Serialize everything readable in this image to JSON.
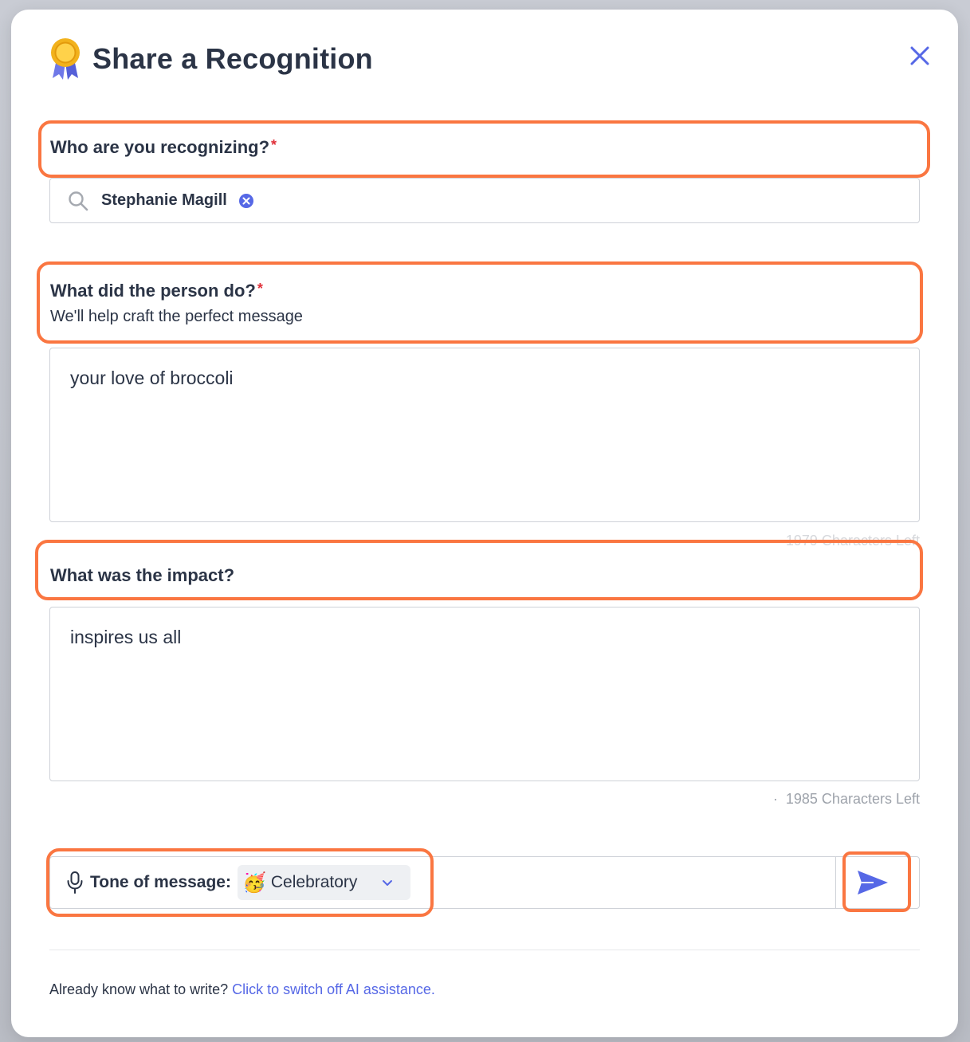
{
  "modal": {
    "title": "Share a Recognition",
    "title_icon": "award-ribbon-icon",
    "close_icon": "close-icon"
  },
  "recipient": {
    "label": "Who are you recognizing?",
    "required_mark": "*",
    "selected_name": "Stephanie Magill"
  },
  "action": {
    "label": "What did the person do?",
    "required_mark": "*",
    "subtext": "We'll help craft the perfect message",
    "value": "your love of broccoli",
    "counter": "1979 Characters Left"
  },
  "impact": {
    "label": "What was the impact?",
    "value": "inspires us all",
    "counter": "1985 Characters Left",
    "counter_bullet": "·"
  },
  "tone": {
    "label": "Tone of message:",
    "emoji": "🥳",
    "value": "Celebratory"
  },
  "footer": {
    "prompt": "Already know what to write?",
    "link": "Click to switch off AI assistance."
  },
  "colors": {
    "accent": "#5668e6",
    "highlight": "#fa7641",
    "required": "#e0303a",
    "text": "#2b3446"
  }
}
